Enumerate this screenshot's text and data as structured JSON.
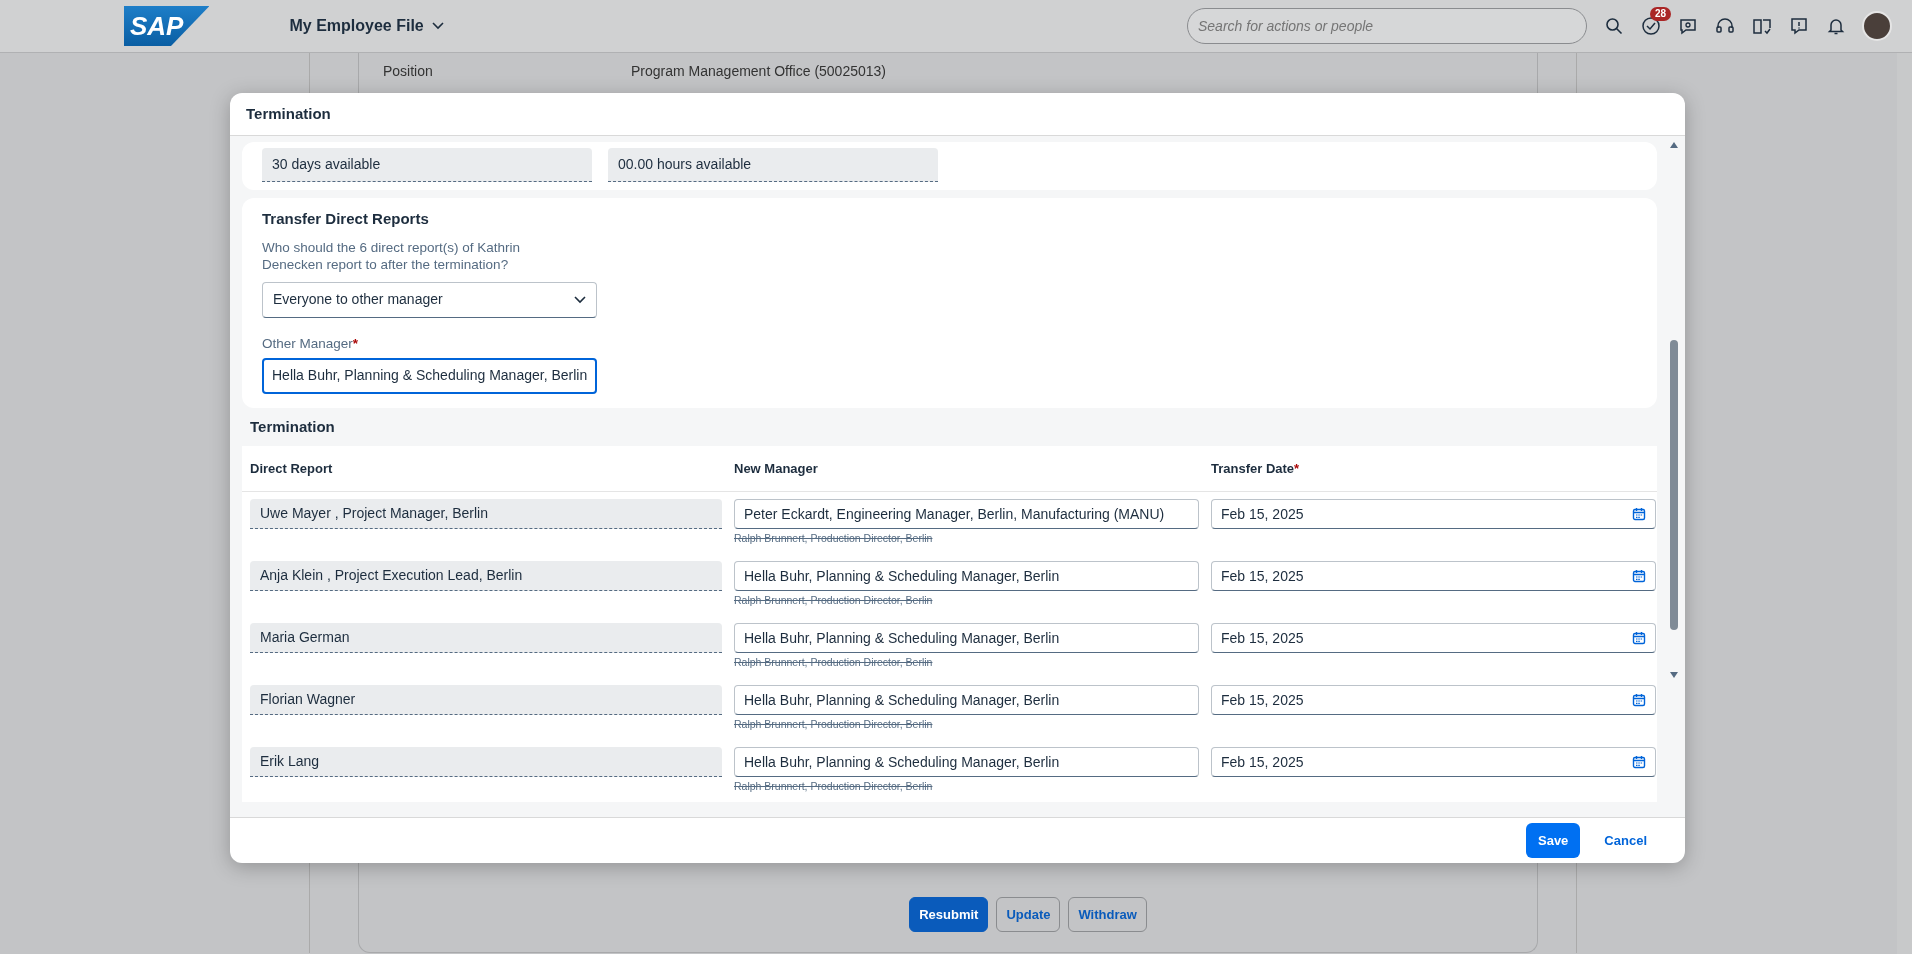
{
  "header": {
    "logo": "SAP",
    "title": "My Employee File",
    "search_placeholder": "Search for actions or people",
    "tasks_badge": "28"
  },
  "background": {
    "position_label": "Position",
    "position_value": "Program Management Office (50025013)",
    "buttons": [
      {
        "label": "Resubmit",
        "kind": "primary"
      },
      {
        "label": "Update",
        "kind": "outline"
      },
      {
        "label": "Withdraw",
        "kind": "outline"
      }
    ]
  },
  "dialog": {
    "title": "Termination",
    "balances": [
      "30 days available",
      "00.00 hours available"
    ],
    "transfer": {
      "title": "Transfer Direct Reports",
      "question": "Who should the 6 direct report(s) of Kathrin Denecken report to after the termination?",
      "option": "Everyone to other manager",
      "other_manager_label": "Other Manager",
      "other_manager_required_mark": "*",
      "other_manager_value": "Hella Buhr, Planning & Scheduling Manager, Berlin"
    },
    "termination": {
      "title": "Termination",
      "columns": [
        {
          "label": "Direct Report"
        },
        {
          "label": "New Manager"
        },
        {
          "label": "Transfer Date",
          "required_mark": "*"
        }
      ],
      "rows": [
        {
          "direct_report": "Uwe Mayer , Project Manager, Berlin",
          "new_manager": "Peter Eckardt, Engineering Manager, Berlin, Manufacturing (MANU)",
          "previous_manager": "Ralph Brunnert, Production Director, Berlin",
          "transfer_date": "Feb 15, 2025"
        },
        {
          "direct_report": "Anja Klein , Project Execution Lead, Berlin",
          "new_manager": "Hella Buhr, Planning & Scheduling Manager, Berlin",
          "previous_manager": "Ralph Brunnert, Production Director, Berlin",
          "transfer_date": "Feb 15, 2025"
        },
        {
          "direct_report": "Maria German",
          "new_manager": "Hella Buhr, Planning & Scheduling Manager, Berlin",
          "previous_manager": "Ralph Brunnert, Production Director, Berlin",
          "transfer_date": "Feb 15, 2025"
        },
        {
          "direct_report": "Florian Wagner",
          "new_manager": "Hella Buhr, Planning & Scheduling Manager, Berlin",
          "previous_manager": "Ralph Brunnert, Production Director, Berlin",
          "transfer_date": "Feb 15, 2025"
        },
        {
          "direct_report": "Erik Lang",
          "new_manager": "Hella Buhr, Planning & Scheduling Manager, Berlin",
          "previous_manager": "Ralph Brunnert, Production Director, Berlin",
          "transfer_date": "Feb 15, 2025"
        }
      ]
    },
    "buttons": [
      {
        "label": "Save",
        "kind": "primary"
      },
      {
        "label": "Cancel",
        "kind": "link"
      }
    ]
  }
}
